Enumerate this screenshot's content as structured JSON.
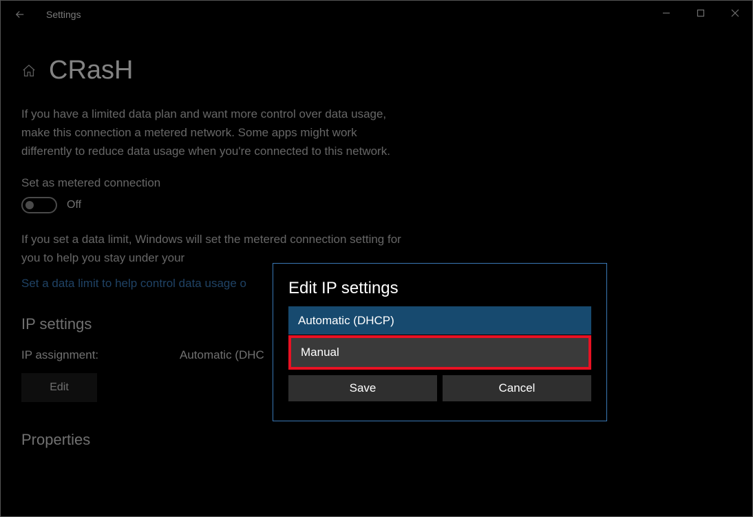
{
  "window": {
    "title": "Settings"
  },
  "page": {
    "name": "CRasH",
    "metered_para": "If you have a limited data plan and want more control over data usage, make this connection a metered network. Some apps might work differently to reduce data usage when you're connected to this network.",
    "metered_label": "Set as metered connection",
    "toggle_state": "Off",
    "limit_para": "If you set a data limit, Windows will set the metered connection setting for you to help you stay under your",
    "limit_link": "Set a data limit to help control data usage o",
    "ip_heading": "IP settings",
    "ip_assignment_label": "IP assignment:",
    "ip_assignment_value": "Automatic (DHC",
    "edit_label": "Edit",
    "properties_heading": "Properties"
  },
  "modal": {
    "title": "Edit IP settings",
    "option_auto": "Automatic (DHCP)",
    "option_manual": "Manual",
    "save": "Save",
    "cancel": "Cancel"
  }
}
